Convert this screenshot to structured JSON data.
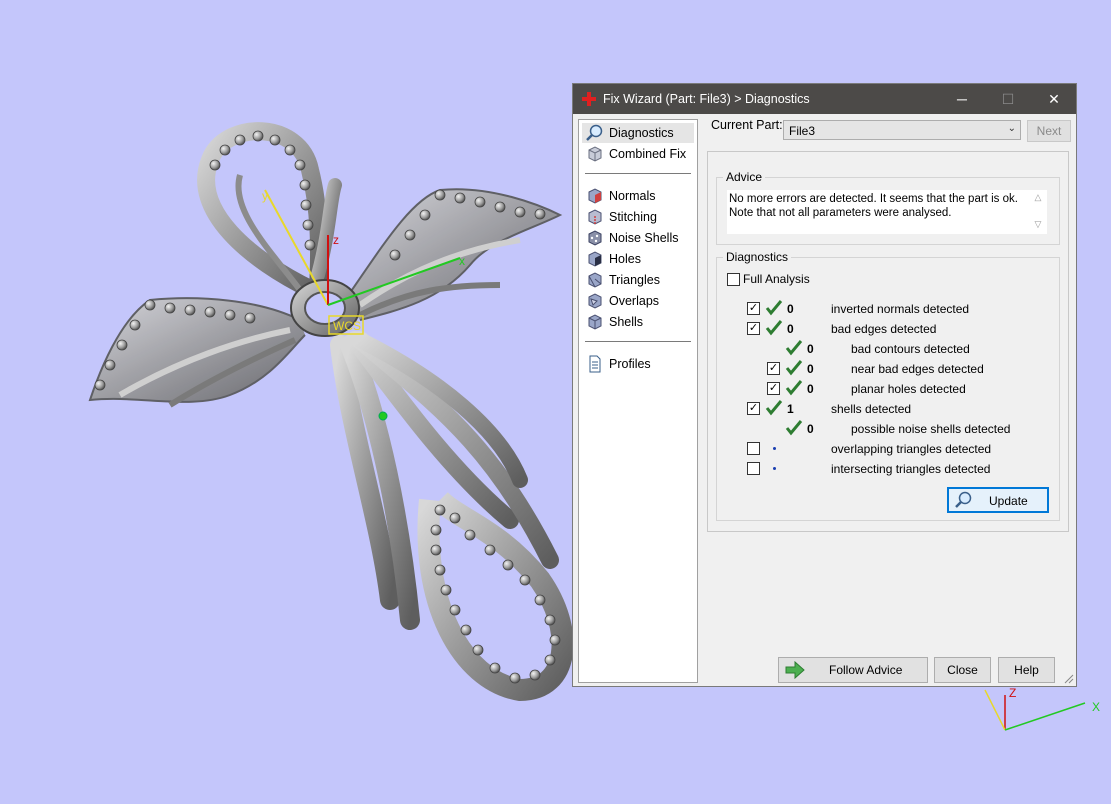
{
  "viewport": {
    "axis_labels": {
      "x": "x",
      "y": "y",
      "z": "z"
    },
    "wcs_label": "WCS",
    "corner_axis_labels": {
      "z": "Z",
      "x": "X"
    },
    "background_color": "#c4c6fb"
  },
  "window": {
    "title": "Fix Wizard (Part: File3) > Diagnostics",
    "minimize": "─",
    "maximize": "☐",
    "close": "✕"
  },
  "nav": {
    "items": [
      {
        "label": "Diagnostics",
        "icon": "magnifier-icon"
      },
      {
        "label": "Combined Fix",
        "icon": "cube-icon"
      },
      {
        "label": "Normals",
        "icon": "normals-cube-icon"
      },
      {
        "label": "Stitching",
        "icon": "stitching-cube-icon"
      },
      {
        "label": "Noise Shells",
        "icon": "noise-shells-icon"
      },
      {
        "label": "Holes",
        "icon": "holes-cube-icon"
      },
      {
        "label": "Triangles",
        "icon": "triangles-cube-icon"
      },
      {
        "label": "Overlaps",
        "icon": "overlaps-cube-icon"
      },
      {
        "label": "Shells",
        "icon": "shells-cube-icon"
      },
      {
        "label": "Profiles",
        "icon": "document-icon"
      }
    ]
  },
  "current_part": {
    "label": "Current Part:",
    "value": "File3"
  },
  "next_button": "Next",
  "advice": {
    "title": "Advice",
    "text": "No more errors are detected. It seems that the part is ok. Note that not all parameters were analysed."
  },
  "diagnostics": {
    "title": "Diagnostics",
    "full_analysis": {
      "label": "Full Analysis",
      "checked": false
    },
    "rows": [
      {
        "checked": true,
        "status": "ok",
        "count": "0",
        "label": "inverted normals detected"
      },
      {
        "checked": true,
        "status": "ok",
        "count": "0",
        "label": "bad edges detected"
      },
      {
        "checked": null,
        "status": "ok",
        "count": "0",
        "label": "bad contours detected"
      },
      {
        "checked": true,
        "status": "ok",
        "count": "0",
        "label": "near bad edges detected"
      },
      {
        "checked": true,
        "status": "ok",
        "count": "0",
        "label": "planar holes detected"
      },
      {
        "checked": true,
        "status": "ok",
        "count": "1",
        "label": "shells detected"
      },
      {
        "checked": null,
        "status": "ok",
        "count": "0",
        "label": "possible noise shells detected"
      },
      {
        "checked": false,
        "status": "not-run",
        "count": "",
        "label": "overlapping triangles detected"
      },
      {
        "checked": false,
        "status": "not-run",
        "count": "",
        "label": "intersecting triangles detected"
      }
    ],
    "update_button": "Update"
  },
  "footer": {
    "follow_advice": "Follow Advice",
    "close": "Close",
    "help": "Help"
  },
  "colors": {
    "ok_tick": "#2e7d32",
    "titlebar": "#4c4a48",
    "x_axis": "#22c922",
    "y_axis": "#e8d82a",
    "z_axis": "#d01010"
  }
}
